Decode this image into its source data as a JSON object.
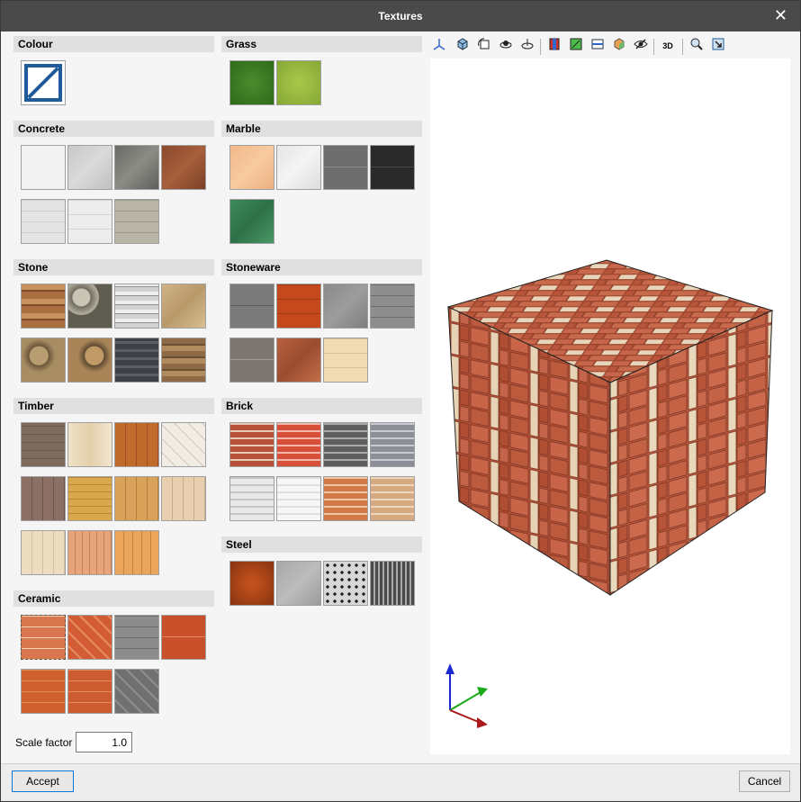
{
  "window": {
    "title": "Textures",
    "close_glyph": "✕"
  },
  "sections": {
    "colour": "Colour",
    "grass": "Grass",
    "concrete": "Concrete",
    "marble": "Marble",
    "stone": "Stone",
    "stoneware": "Stoneware",
    "timber": "Timber",
    "brick": "Brick",
    "steel": "Steel",
    "ceramic": "Ceramic"
  },
  "scale": {
    "label": "Scale factor",
    "value": "1.0"
  },
  "buttons": {
    "accept": "Accept",
    "cancel": "Cancel"
  },
  "toolbar": {
    "icons": [
      "axes-icon",
      "view-cube-icon",
      "rotate-icon",
      "orbit-icon",
      "pan-orbit-icon",
      "section-icon",
      "zoom-region-icon",
      "plane-icon",
      "shaded-icon",
      "visibility-icon",
      "3d-view-icon",
      "zoom-icon",
      "zoom-extents-icon"
    ],
    "threed_label": "3D"
  },
  "colors": {
    "title_bg": "#4a4a4a",
    "accent": "#1f5a9a",
    "brick": "#b85a3c"
  }
}
